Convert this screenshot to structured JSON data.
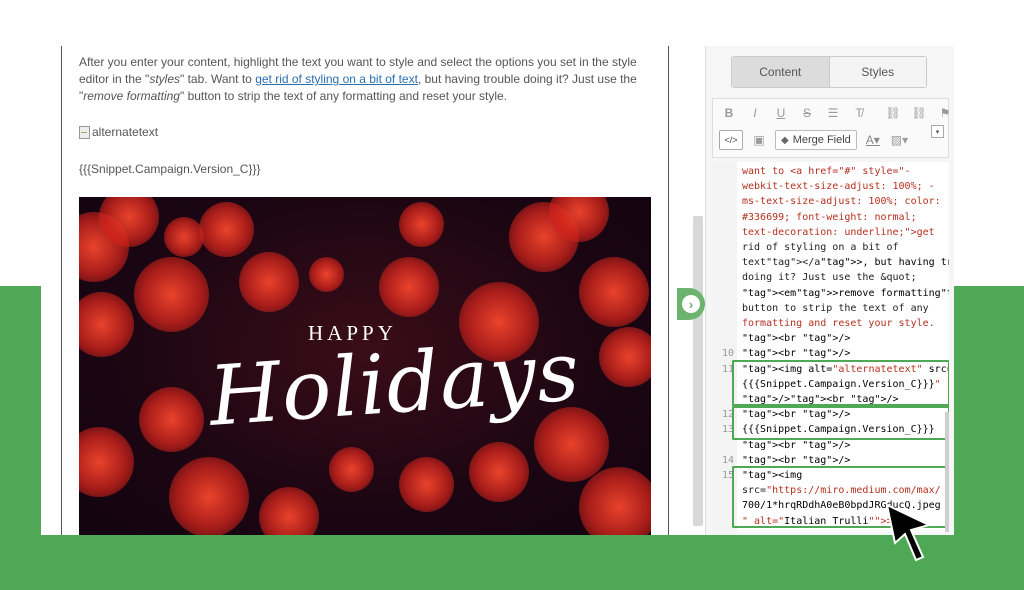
{
  "preview": {
    "para_1": "After you enter your content, highlight the text you want to style and select the options you set in the style editor in the \"",
    "para_styles": "styles",
    "para_2": "\" tab. Want to ",
    "para_link": "get rid of styling on a bit of text",
    "para_3": ", but having trouble doing it? Just use the \"",
    "para_remove": "remove formatting",
    "para_4": "\" button to strip the text of any formatting and reset your style.",
    "alt_text": "alternatetext",
    "snippet": "{{{Snippet.Campaign.Version_C}}}",
    "image_happy": "HAPPY",
    "image_holidays": "Holidays"
  },
  "panel": {
    "tab_content": "Content",
    "tab_styles": "Styles",
    "toolbar": {
      "bold": "B",
      "italic": "I",
      "underline": "U",
      "strike": "S",
      "merge_field": "Merge Field",
      "font_color": "A"
    }
  },
  "code_lines": [
    {
      "n": "",
      "t": "want to <a href=\"#\" style=\"-"
    },
    {
      "n": "",
      "t": "webkit-text-size-adjust: 100%; -"
    },
    {
      "n": "",
      "t": "ms-text-size-adjust: 100%; color:"
    },
    {
      "n": "",
      "t": "#336699; font-weight: normal;"
    },
    {
      "n": "",
      "t": "text-decoration: underline;\">get"
    },
    {
      "n": "",
      "t": "rid of styling on a bit of"
    },
    {
      "n": "",
      "t": "text</a>, but having trouble"
    },
    {
      "n": "",
      "t": "doing it? Just use the &quot;"
    },
    {
      "n": "",
      "t": "<em>remove formatting</em>&quot;"
    },
    {
      "n": "",
      "t": "button to strip the text of any"
    },
    {
      "n": "",
      "t": "formatting and reset your style."
    },
    {
      "n": "",
      "t": "<br />"
    },
    {
      "n": "10",
      "t": "<br />"
    },
    {
      "n": "11",
      "t": "<img alt=\"alternatetext\" src=\""
    },
    {
      "n": "",
      "t": "{{{Snippet.Campaign.Version_C}}}\""
    },
    {
      "n": "",
      "t": "/><br />"
    },
    {
      "n": "12",
      "t": "<br />"
    },
    {
      "n": "13",
      "t": "{{{Snippet.Campaign.Version_C}}}"
    },
    {
      "n": "",
      "t": "<br />"
    },
    {
      "n": "14",
      "t": "<br />"
    },
    {
      "n": "15",
      "t": "<img"
    },
    {
      "n": "",
      "t": "src=\"https://miro.medium.com/max/"
    },
    {
      "n": "",
      "t": "700/1*hrqRDdhA0eB0bpdJRGducQ.jpeg"
    },
    {
      "n": "",
      "t": "\" alt=\"Italian Trulli\">"
    }
  ],
  "colors": {
    "green": "#4ea856",
    "link": "#2a6fb0",
    "code_string": "#b5301f",
    "code_tag": "#1c8a1c"
  }
}
